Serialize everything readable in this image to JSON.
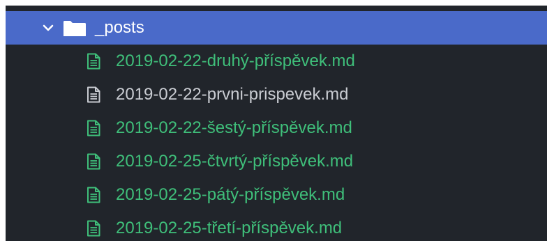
{
  "folder": {
    "name": "_posts",
    "expanded": true,
    "icon": "folder-icon",
    "toggle_icon": "chevron-down-icon"
  },
  "colors": {
    "background": "#21252b",
    "selected_row": "#4a6ac9",
    "modified_file": "#3fbf7a",
    "unmodified_file": "#c9ccd2"
  },
  "files": [
    {
      "name": "2019-02-22-druhý-příspěvek.md",
      "status": "modified",
      "icon": "file-text-icon"
    },
    {
      "name": "2019-02-22-prvni-prispevek.md",
      "status": "unmodified",
      "icon": "file-text-icon"
    },
    {
      "name": "2019-02-22-šestý-příspěvek.md",
      "status": "modified",
      "icon": "file-text-icon"
    },
    {
      "name": "2019-02-25-čtvrtý-příspěvek.md",
      "status": "modified",
      "icon": "file-text-icon"
    },
    {
      "name": "2019-02-25-pátý-příspěvek.md",
      "status": "modified",
      "icon": "file-text-icon"
    },
    {
      "name": "2019-02-25-třetí-příspěvek.md",
      "status": "modified",
      "icon": "file-text-icon"
    }
  ]
}
